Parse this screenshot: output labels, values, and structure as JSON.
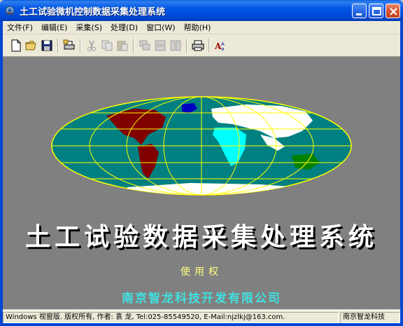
{
  "window": {
    "title": "土工试验微机控制数据采集处理系统"
  },
  "menu": {
    "items": [
      {
        "label": "文件(F)"
      },
      {
        "label": "编辑(E)"
      },
      {
        "label": "采集(S)"
      },
      {
        "label": "处理(D)"
      },
      {
        "label": "窗口(W)"
      },
      {
        "label": "帮助(H)"
      }
    ]
  },
  "toolbar": {
    "buttons": [
      "new-file-icon",
      "open-folder-icon",
      "save-disk-icon",
      "print-setup-icon",
      "cut-icon",
      "copy-icon",
      "paste-icon",
      "cascade-icon",
      "tile-horizontal-icon",
      "tile-vertical-icon",
      "print-icon",
      "font-icon"
    ]
  },
  "splash": {
    "title": "土工试验数据采集处理系统",
    "license_label": "使用权",
    "company": "南京智龙科技开发有限公司"
  },
  "status": {
    "info": "Windows 视窗版. 版权所有, 作者: 袁 龙, Tel:025-85549520, E-Mail:njzlkj@163.com.",
    "company": "南京智龙科技"
  },
  "colors": {
    "titlebar": "#0055e5",
    "client_bg": "#808080",
    "ocean": "#008080",
    "grid": "#ffff00",
    "title_text": "#ffffff",
    "license_text": "#ffff80",
    "company_text": "#40e0e0"
  }
}
